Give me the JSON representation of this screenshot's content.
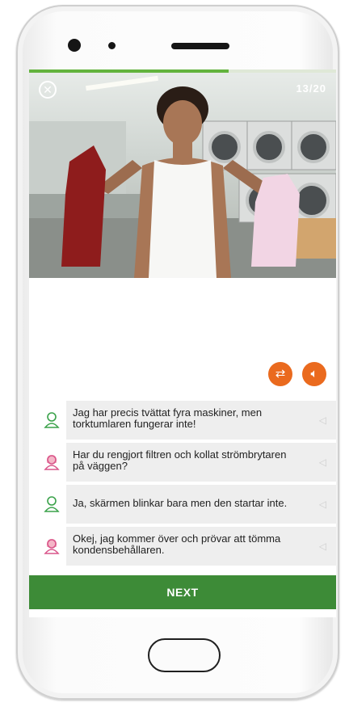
{
  "lesson": {
    "counter": "13/20",
    "progress_fraction": 0.65,
    "close_icon": "close-circle-icon",
    "next_label": "NEXT"
  },
  "controls": {
    "swap_icon": "swap-arrows-icon",
    "speaker_icon": "speaker-icon",
    "accent_color": "#ea6a1e",
    "primary_color": "#3d8b37"
  },
  "dialogue": [
    {
      "speaker": "male",
      "text": "Jag har precis tvättat fyra maskiner, men torktumlaren fungerar inte!"
    },
    {
      "speaker": "female",
      "text": "Har du rengjort filtren och kollat strömbrytaren på väggen?"
    },
    {
      "speaker": "male",
      "text": "Ja, skärmen blinkar bara men den startar inte."
    },
    {
      "speaker": "female",
      "text": "Okej, jag kommer över och prövar att tömma kondensbehållaren."
    }
  ]
}
